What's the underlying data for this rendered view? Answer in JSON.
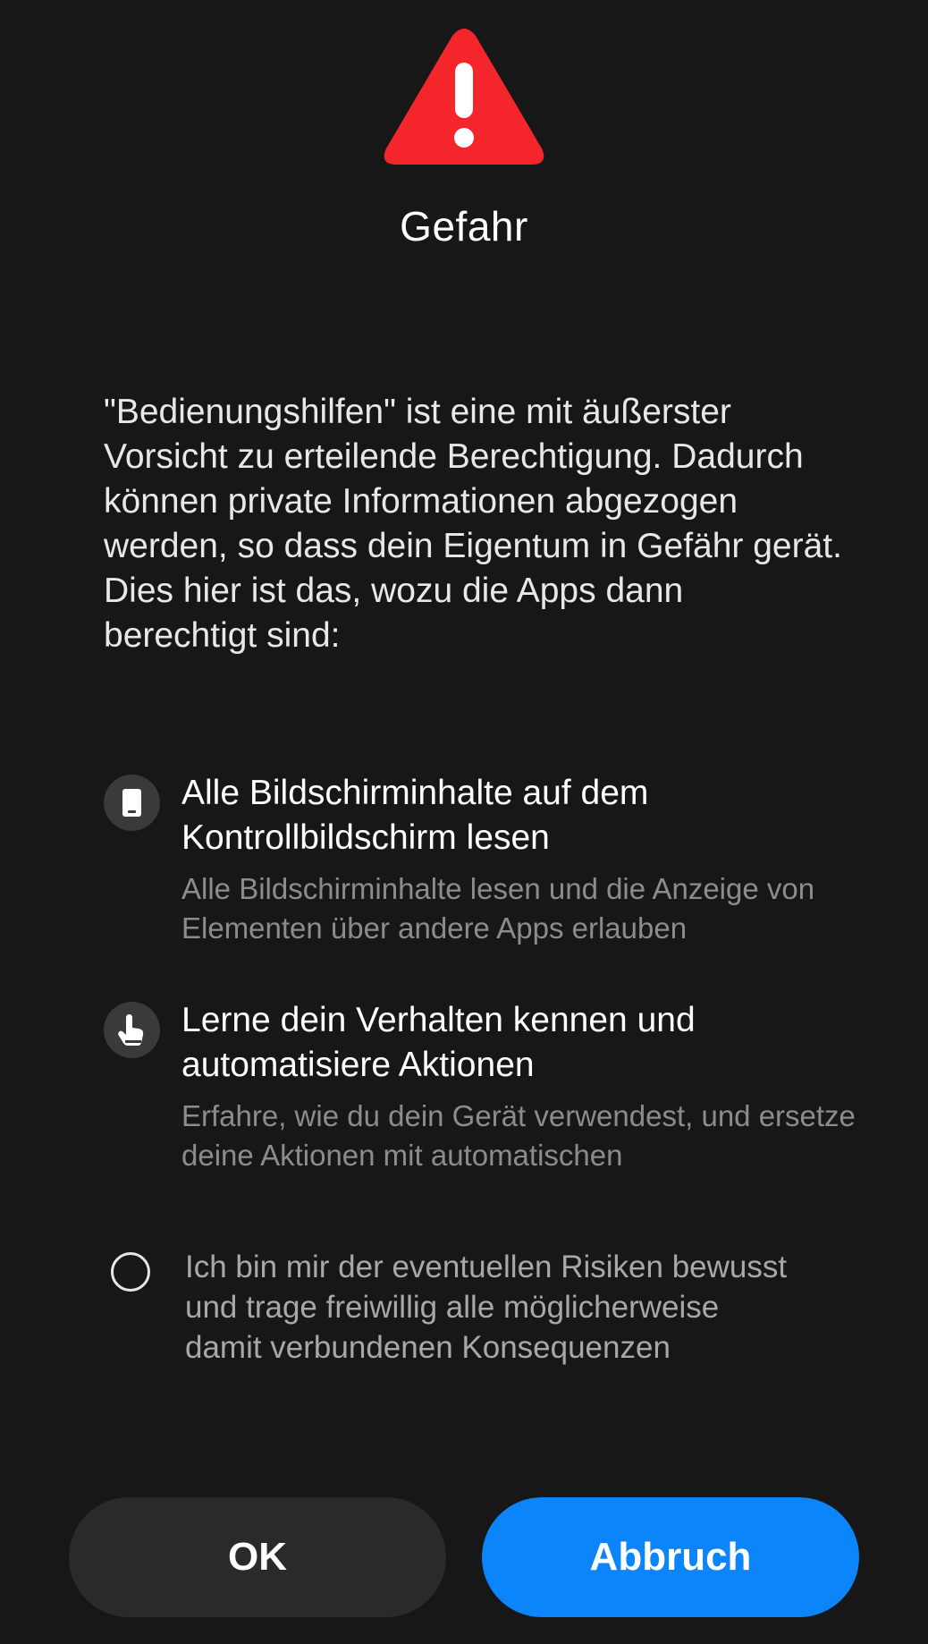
{
  "dialog": {
    "title": "Gefahr",
    "description": "\"Bedienungshilfen\" ist eine mit äußerster Vorsicht zu erteilende Berechtigung. Dadurch können private Informationen abgezogen werden, so dass dein Eigentum in Gefähr gerät. Dies hier ist das, wozu die Apps dann berechtigt sind:",
    "warning_icon": "warning-triangle-icon",
    "accent_color": "#F5262B"
  },
  "permissions": [
    {
      "icon": "phone-icon",
      "title": "Alle Bildschirminhalte auf dem Kontrollbildschirm lesen",
      "subtitle": "Alle Bildschirminhalte lesen und die Anzeige von Elementen über andere Apps erlauben"
    },
    {
      "icon": "hand-tap-icon",
      "title": "Lerne dein Verhalten kennen und automatisiere Aktionen",
      "subtitle": "Erfahre, wie du dein Gerät verwendest, und ersetze deine Aktionen mit automatischen"
    }
  ],
  "consent": {
    "checked": false,
    "text": "Ich bin mir der eventuellen Risiken bewusst und trage freiwillig alle möglicherweise damit verbundenen Konsequenzen"
  },
  "buttons": {
    "ok_label": "OK",
    "cancel_label": "Abbruch",
    "cancel_color": "#0C84FA"
  }
}
